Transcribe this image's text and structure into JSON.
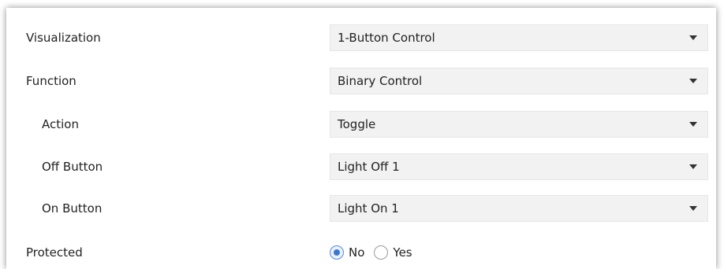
{
  "rows": [
    {
      "label": "Visualization",
      "value": "1-Button Control"
    },
    {
      "label": "Function",
      "value": "Binary Control"
    },
    {
      "label": "Action",
      "value": "Toggle"
    },
    {
      "label": "Off Button",
      "value": "Light Off 1"
    },
    {
      "label": "On Button",
      "value": "Light On 1"
    }
  ],
  "protected": {
    "label": "Protected",
    "options": [
      {
        "label": "No",
        "checked": true
      },
      {
        "label": "Yes",
        "checked": false
      }
    ]
  },
  "icons": {
    "dropdown": "chevron-down-icon",
    "radio": "radio-icon"
  },
  "colors": {
    "select_bg": "#f2f2f2",
    "radio_accent": "#3f77c8"
  }
}
